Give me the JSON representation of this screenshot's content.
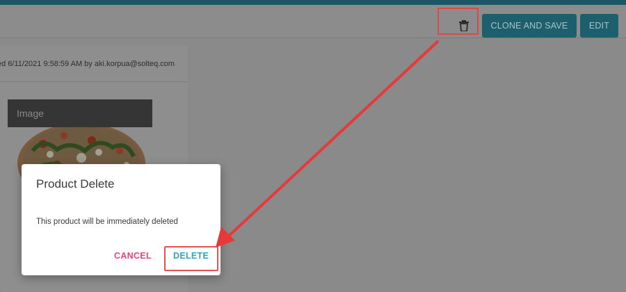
{
  "toolbar": {
    "clone_label": "CLONE AND SAVE",
    "edit_label": "EDIT"
  },
  "card": {
    "modified_text": "ed 6/11/2021 9:58:59 AM by aki.korpua@solteq.com",
    "image_label": "Image"
  },
  "dialog": {
    "title": "Product Delete",
    "message": "This product will be immediately deleted",
    "cancel_label": "CANCEL",
    "delete_label": "DELETE"
  },
  "colors": {
    "accent_teal": "#1e5f6d",
    "cancel_pink": "#e8457a",
    "delete_cyan": "#2aa6c0",
    "annotation_red": "#e63a3a"
  },
  "icons": {
    "trash": "trash-icon"
  }
}
